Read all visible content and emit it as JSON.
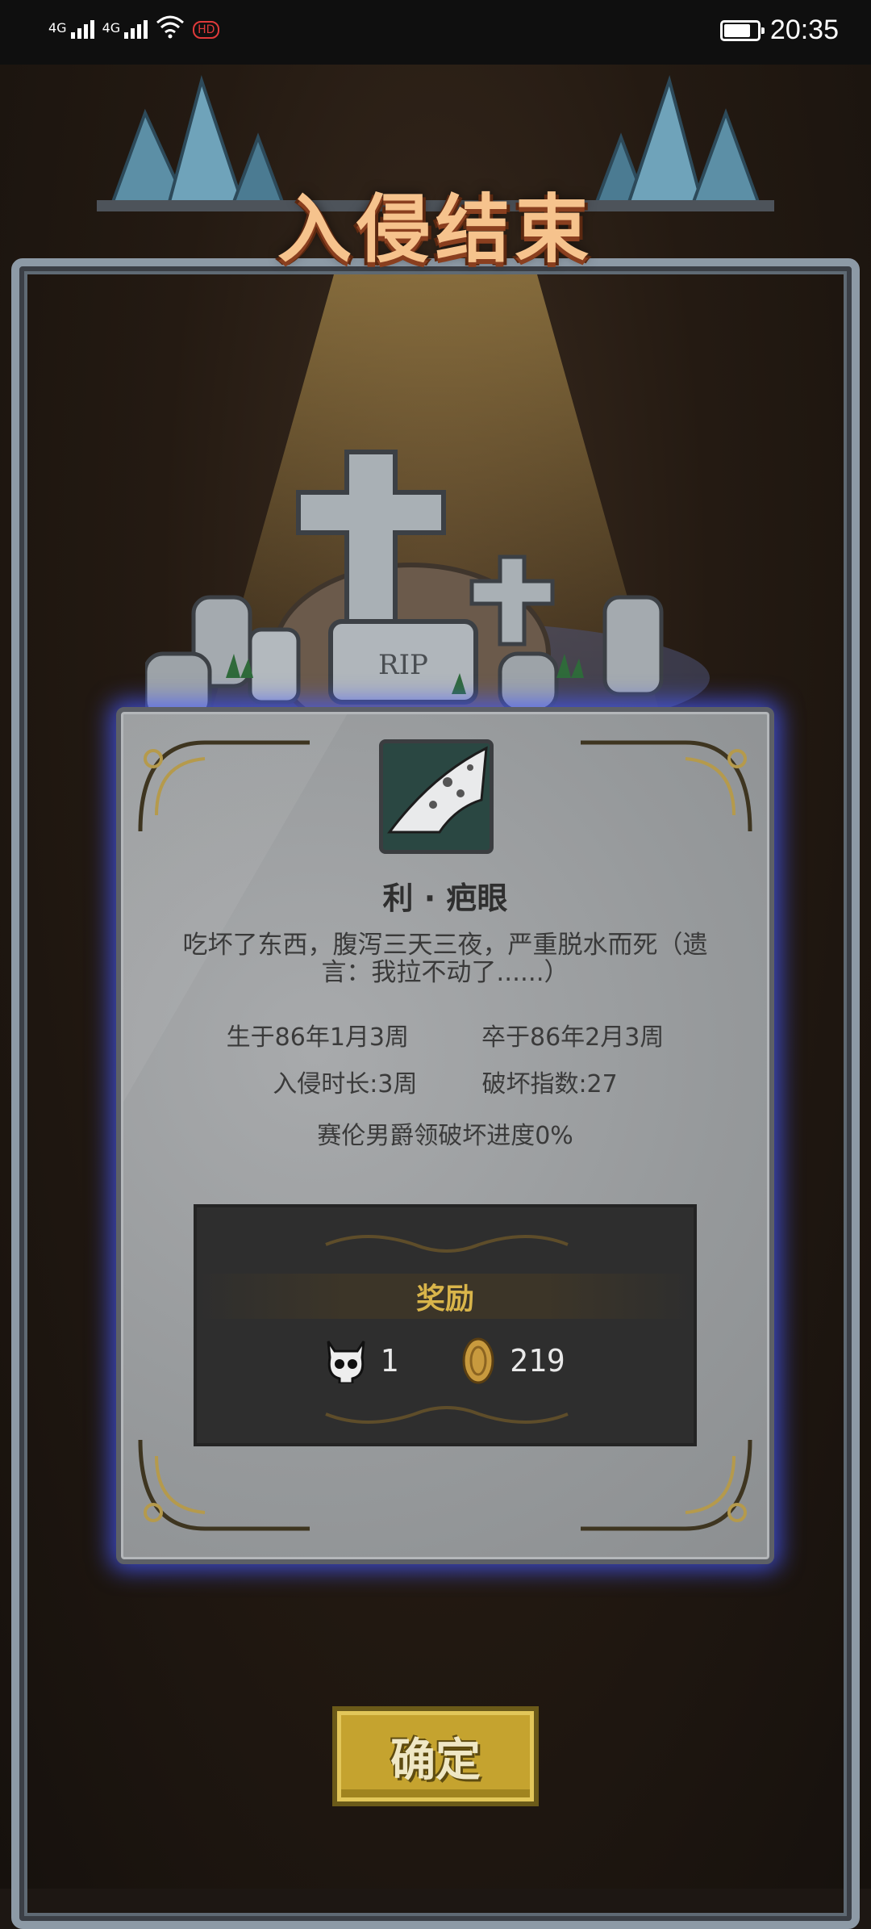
{
  "status_bar": {
    "signal1_label": "4G",
    "signal2_label": "4G",
    "hd_badge": "HD",
    "battery_level": 0.8,
    "time": "20:35"
  },
  "header": {
    "title": "入侵结束"
  },
  "tombstone": {
    "rip_text": "RIP"
  },
  "card": {
    "item_icon": "bone-blade-icon",
    "name": "利 · 疤眼",
    "epitaph": "吃坏了东西，腹泻三天三夜，严重脱水而死（遗言：我拉不动了......）",
    "born": "生于86年1月3周",
    "died": "卒于86年2月3周",
    "invasion_duration": "入侵时长:3周",
    "destruction_index": "破坏指数:27",
    "territory_progress": "赛伦男爵领破坏进度0%"
  },
  "reward": {
    "title": "奖励",
    "items": [
      {
        "icon": "skull-icon",
        "amount": "1"
      },
      {
        "icon": "gold-coin-icon",
        "amount": "219"
      }
    ]
  },
  "actions": {
    "confirm_label": "确定"
  },
  "colors": {
    "panel_glow": "#4660ff",
    "button_gold": "#c5a32f",
    "reward_gold": "#d9b54a",
    "title_orange": "#f6c38d"
  }
}
